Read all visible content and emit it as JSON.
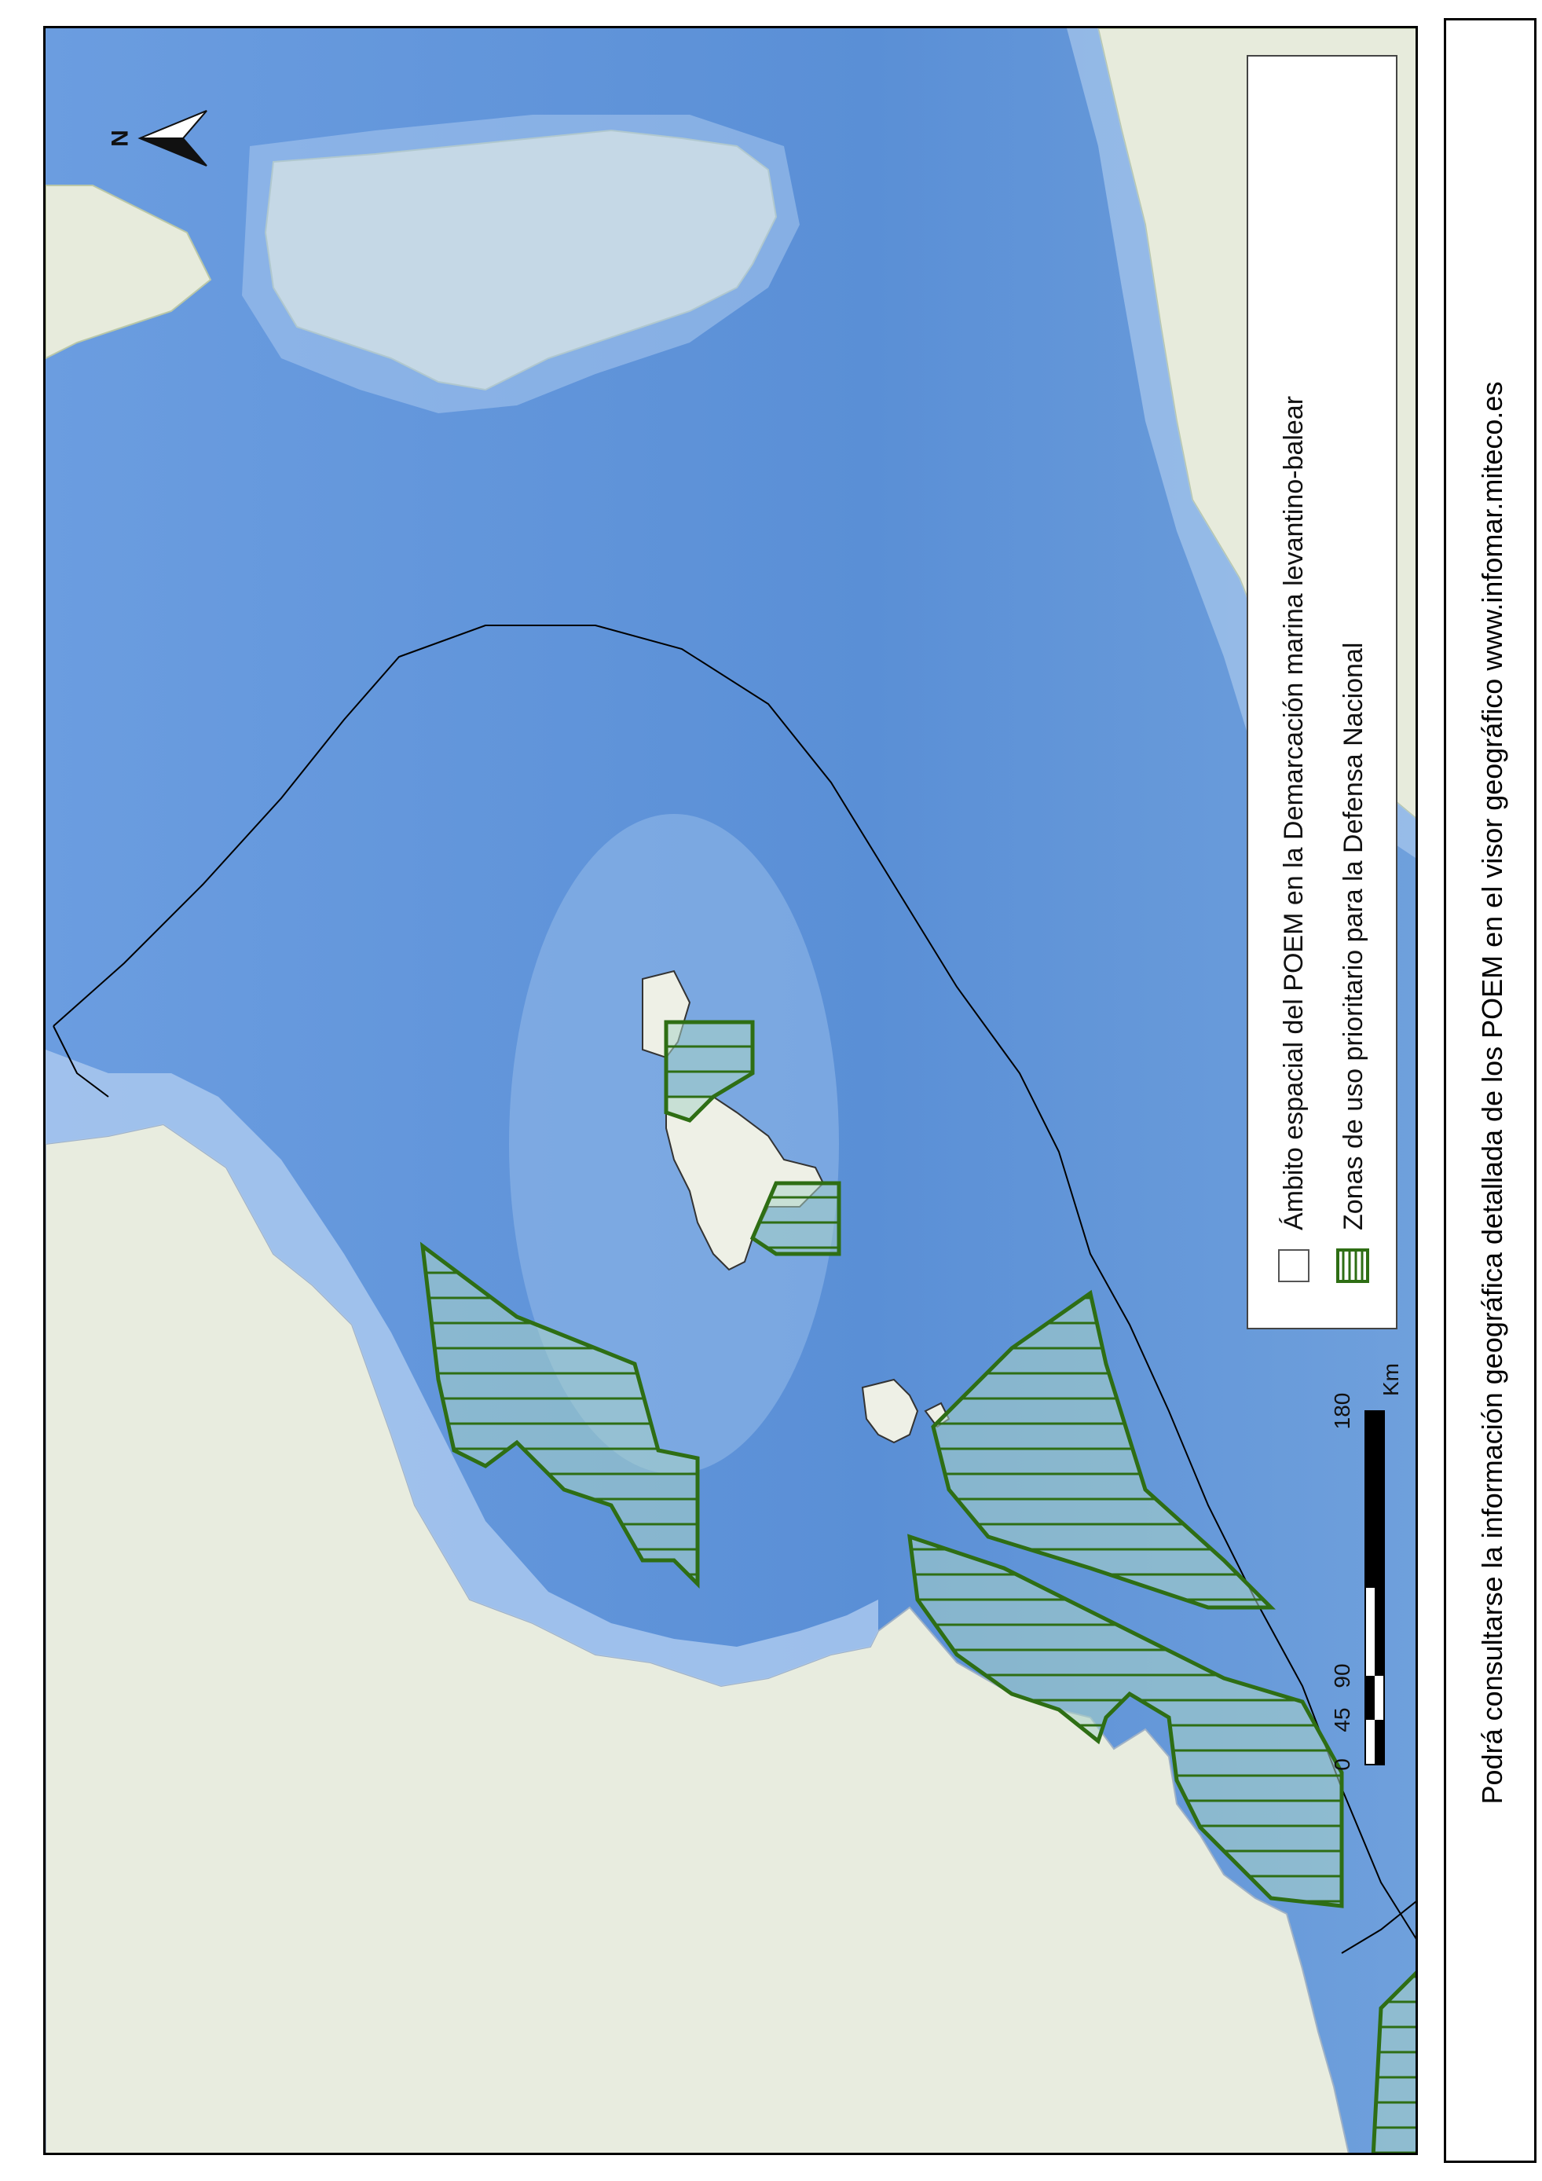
{
  "map": {
    "legend": {
      "items": [
        {
          "label": "Ámbito espacial del POEM en la Demarcación marina levantino-balear",
          "symbol": "outline-box"
        },
        {
          "label": "Zonas de uso prioritario para la  Defensa Nacional",
          "symbol": "green-hatched-box",
          "color": "#2e6e14"
        }
      ]
    },
    "scale_bar": {
      "labels": [
        "0",
        "45",
        "90",
        "180"
      ],
      "unit": "Km"
    },
    "north_arrow": {
      "label": "N"
    },
    "colors": {
      "sea_deep": "#5b8fd6",
      "sea_shelf": "#a9c8ee",
      "land": "#e9ece0",
      "zone": "#2e6e14",
      "zone_fill": "#a9d3c6"
    }
  },
  "footer": {
    "text": "Podrá consultarse la información geográfica detallada de los POEM en el visor geográfico www.infomar.miteco.es"
  }
}
